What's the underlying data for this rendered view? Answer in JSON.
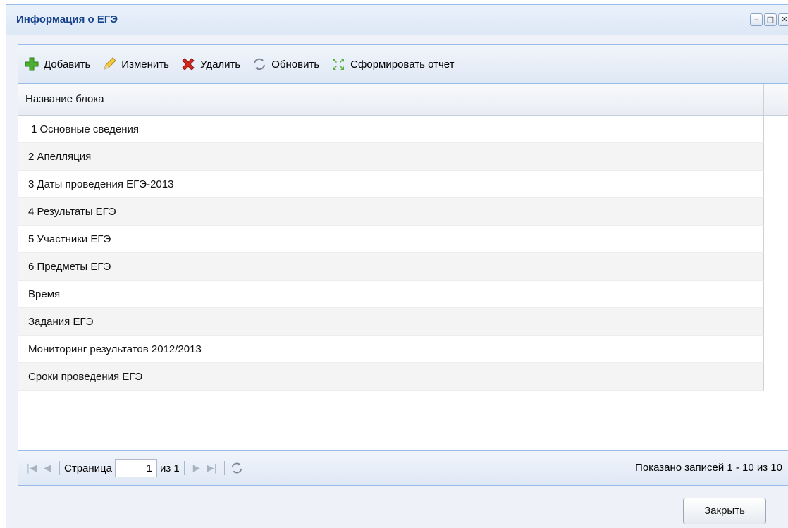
{
  "window": {
    "title": "Информация о ЕГЭ"
  },
  "toolbar": {
    "add_label": "Добавить",
    "edit_label": "Изменить",
    "delete_label": "Удалить",
    "refresh_label": "Обновить",
    "report_label": "Сформировать отчет"
  },
  "grid": {
    "column_header": "Название блока",
    "rows": [
      {
        "label": "1 Основные сведения",
        "indent": true
      },
      {
        "label": "2 Апелляция",
        "indent": false
      },
      {
        "label": "3 Даты проведения ЕГЭ-2013",
        "indent": false
      },
      {
        "label": "4 Результаты ЕГЭ",
        "indent": false
      },
      {
        "label": "5 Участники ЕГЭ",
        "indent": false
      },
      {
        "label": "6 Предметы ЕГЭ",
        "indent": false
      },
      {
        "label": "Время",
        "indent": false
      },
      {
        "label": "Задания ЕГЭ",
        "indent": false
      },
      {
        "label": "Мониторинг результатов 2012/2013",
        "indent": false
      },
      {
        "label": "Сроки проведения ЕГЭ",
        "indent": false
      }
    ]
  },
  "pager": {
    "page_label": "Страница",
    "page_value": "1",
    "of_label": "из 1",
    "records_info": "Показано записей 1 - 10 из 10"
  },
  "footer": {
    "close_label": "Закрыть"
  },
  "icons": {
    "add": "plus-icon",
    "edit": "pencil-icon",
    "delete": "x-icon",
    "refresh": "refresh-icon",
    "report": "report-icon"
  },
  "colors": {
    "title": "#15428b",
    "border": "#99bbe8",
    "add": "#4caf32",
    "delete": "#d8281c"
  }
}
